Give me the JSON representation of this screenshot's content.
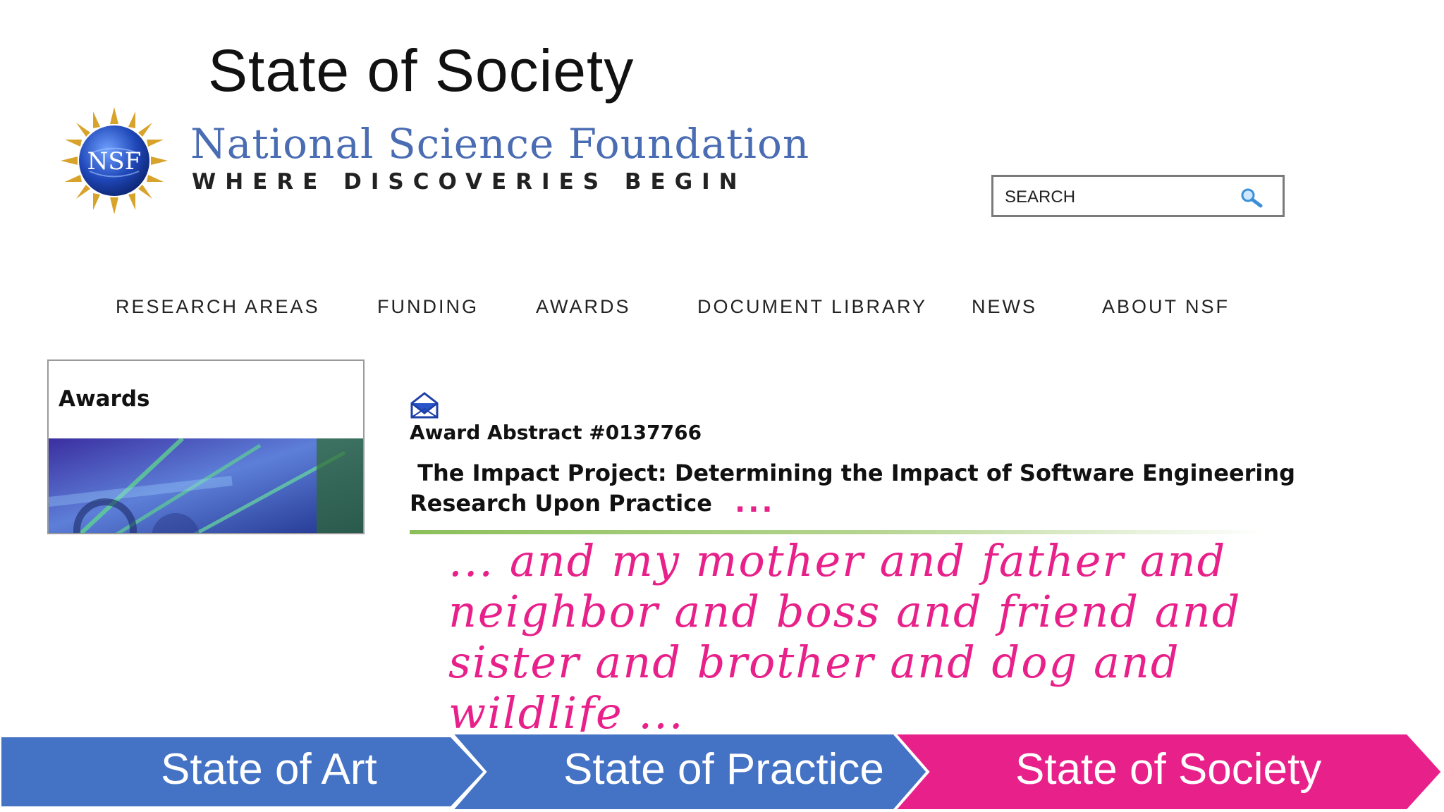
{
  "slide": {
    "title": "State of Society"
  },
  "nsf": {
    "logo_text": "NSF",
    "name": "National Science Foundation",
    "tagline": "WHERE DISCOVERIES BEGIN"
  },
  "search": {
    "placeholder": "SEARCH",
    "value": ""
  },
  "nav": {
    "items": [
      {
        "label": "RESEARCH AREAS"
      },
      {
        "label": "FUNDING"
      },
      {
        "label": "AWARDS"
      },
      {
        "label": "DOCUMENT LIBRARY"
      },
      {
        "label": "NEWS"
      },
      {
        "label": "ABOUT NSF"
      }
    ]
  },
  "sidebar": {
    "heading": "Awards"
  },
  "abstract": {
    "id": "Award Abstract #0137766",
    "title": " The Impact Project: Determining the Impact of Software Engineering Research Upon Practice",
    "ellipsis": "...",
    "annotation": "... and my mother and father and neighbor and boss and friend and sister and brother and dog and wildlife ..."
  },
  "progression": {
    "stages": [
      {
        "label": "State of Art",
        "color": "#4472c4"
      },
      {
        "label": "State of Practice",
        "color": "#4472c4"
      },
      {
        "label": "State of Society",
        "color": "#e8208a"
      }
    ]
  },
  "colors": {
    "accent_pink": "#e8208a",
    "nsf_blue": "#4a6cb3",
    "chevron_blue": "#4472c4"
  }
}
